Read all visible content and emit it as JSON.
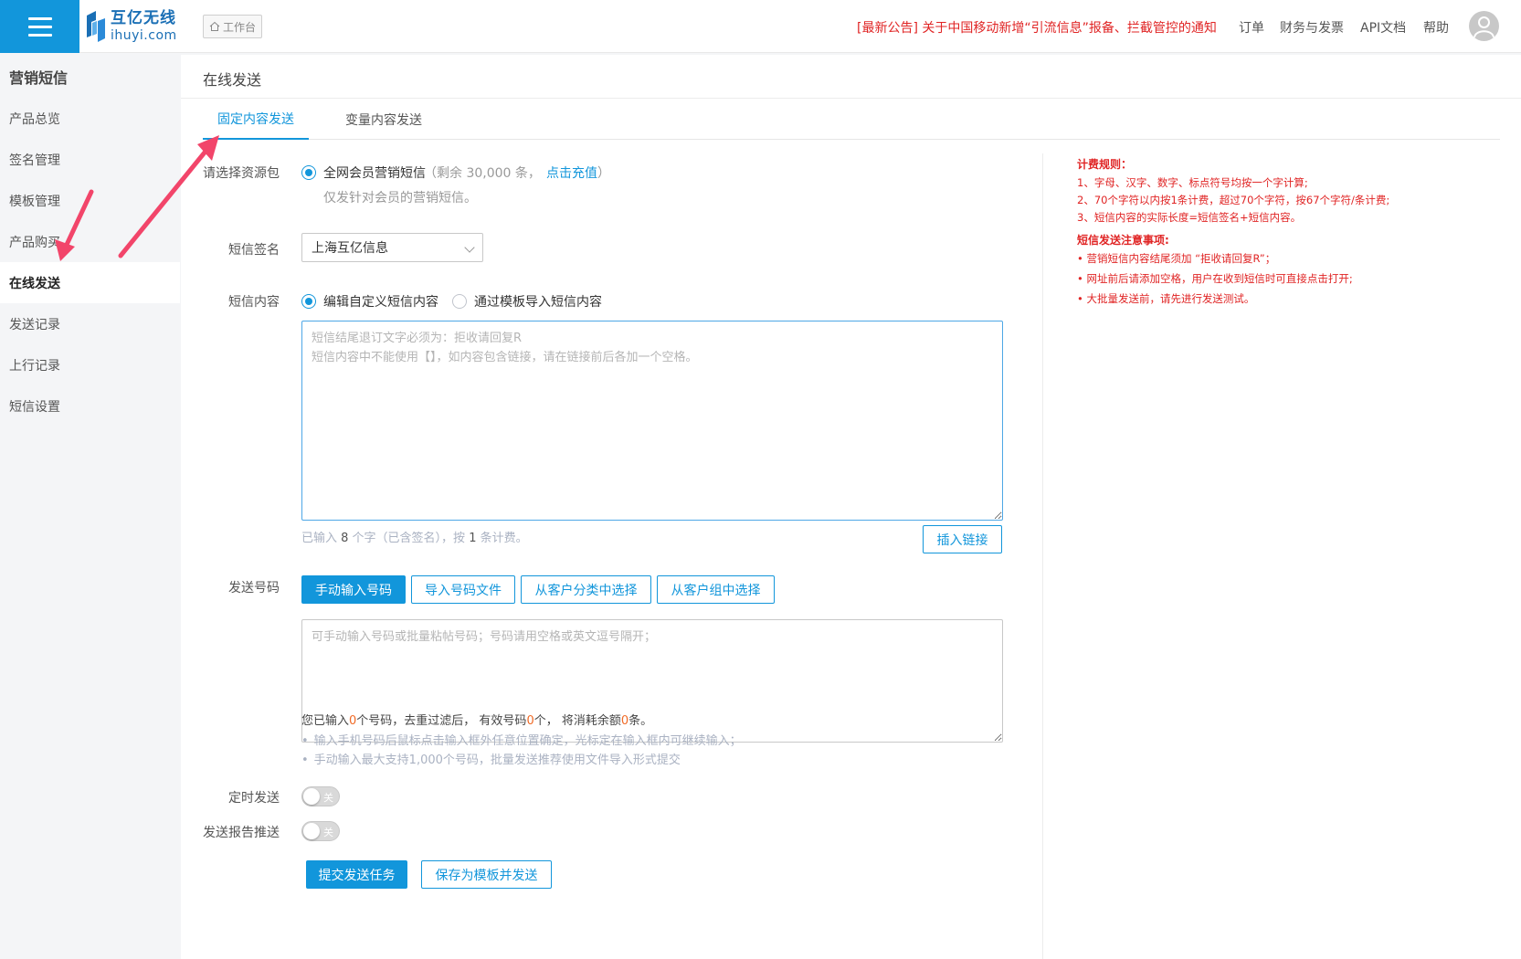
{
  "header": {
    "logo_cn": "互亿无线",
    "logo_en": "ihuyi.com",
    "workbench": "工作台",
    "notice": "[最新公告] 关于中国移动新增“引流信息”报备、拦截管控的通知",
    "nav": [
      "订单",
      "财务与发票",
      "API文档",
      "帮助"
    ]
  },
  "sidebar": {
    "title": "营销短信",
    "items": [
      {
        "label": "产品总览"
      },
      {
        "label": "签名管理"
      },
      {
        "label": "模板管理"
      },
      {
        "label": "产品购买"
      },
      {
        "label": "在线发送"
      },
      {
        "label": "发送记录"
      },
      {
        "label": "上行记录"
      },
      {
        "label": "短信设置"
      }
    ],
    "active_index": 4
  },
  "main": {
    "title": "在线发送",
    "tabs": [
      {
        "label": "固定内容发送",
        "active": true
      },
      {
        "label": "变量内容发送",
        "active": false
      }
    ]
  },
  "form": {
    "package_label": "请选择资源包",
    "package_name": "全网会员营销短信",
    "package_remaining_prefix": "（剩余 30,000 条，",
    "recharge_link": "点击充值",
    "package_remaining_suffix": "）",
    "package_note": "仅发针对会员的营销短信。",
    "signature_label": "短信签名",
    "signature_value": "上海互亿信息",
    "content_label": "短信内容",
    "content_option_1": "编辑自定义短信内容",
    "content_option_2": "通过模板导入短信内容",
    "content_placeholder": "短信结尾退订文字必须为：拒收请回复R\n短信内容中不能使用【】，如内容包含链接，请在链接前后各加一个空格。",
    "content_count_a": "已输入 ",
    "content_count_n": "8",
    "content_count_b": " 个字（已含签名），按 ",
    "content_count_m": "1",
    "content_count_c": " 条计费。",
    "insert_link": "插入链接",
    "numbers_label": "发送号码",
    "numbers_buttons": [
      "手动输入号码",
      "导入号码文件",
      "从客户分类中选择",
      "从客户组中选择"
    ],
    "numbers_placeholder": "可手动输入号码或批量粘帖号码；号码请用空格或英文逗号隔开；",
    "count_a": "您已输入",
    "count_n1": "0",
    "count_b": "个号码，去重过滤后， 有效号码",
    "count_n2": "0",
    "count_c": "个， 将消耗余额",
    "count_n3": "0",
    "count_d": "条。",
    "hints": [
      "输入手机号码后鼠标点击输入框外任意位置确定，光标定在输入框内可继续输入；",
      "手动输入最大支持1,000个号码，批量发送推荐使用文件导入形式提交"
    ],
    "schedule_label": "定时发送",
    "report_label": "发送报告推送",
    "toggle_off": "关",
    "submit": "提交发送任务",
    "save_template": "保存为模板并发送"
  },
  "rules": {
    "billing_title": "计费规则：",
    "billing_lines": [
      "1、字母、汉字、数字、标点符号均按一个字计算;",
      "2、70个字符以内按1条计费，超过70个字符，按67个字符/条计费;",
      "3、短信内容的实际长度=短信签名+短信内容。"
    ],
    "notice_title": "短信发送注意事项:",
    "notice_lines": [
      "• 营销短信内容结尾须加 “拒收请回复R”；",
      "• 网址前后请添加空格，用户在收到短信时可直接点击打开;",
      "• 大批量发送前，请先进行发送测试。"
    ]
  },
  "colors": {
    "accent": "#1296db",
    "alert": "#e02424",
    "arrow": "#f2456a"
  }
}
